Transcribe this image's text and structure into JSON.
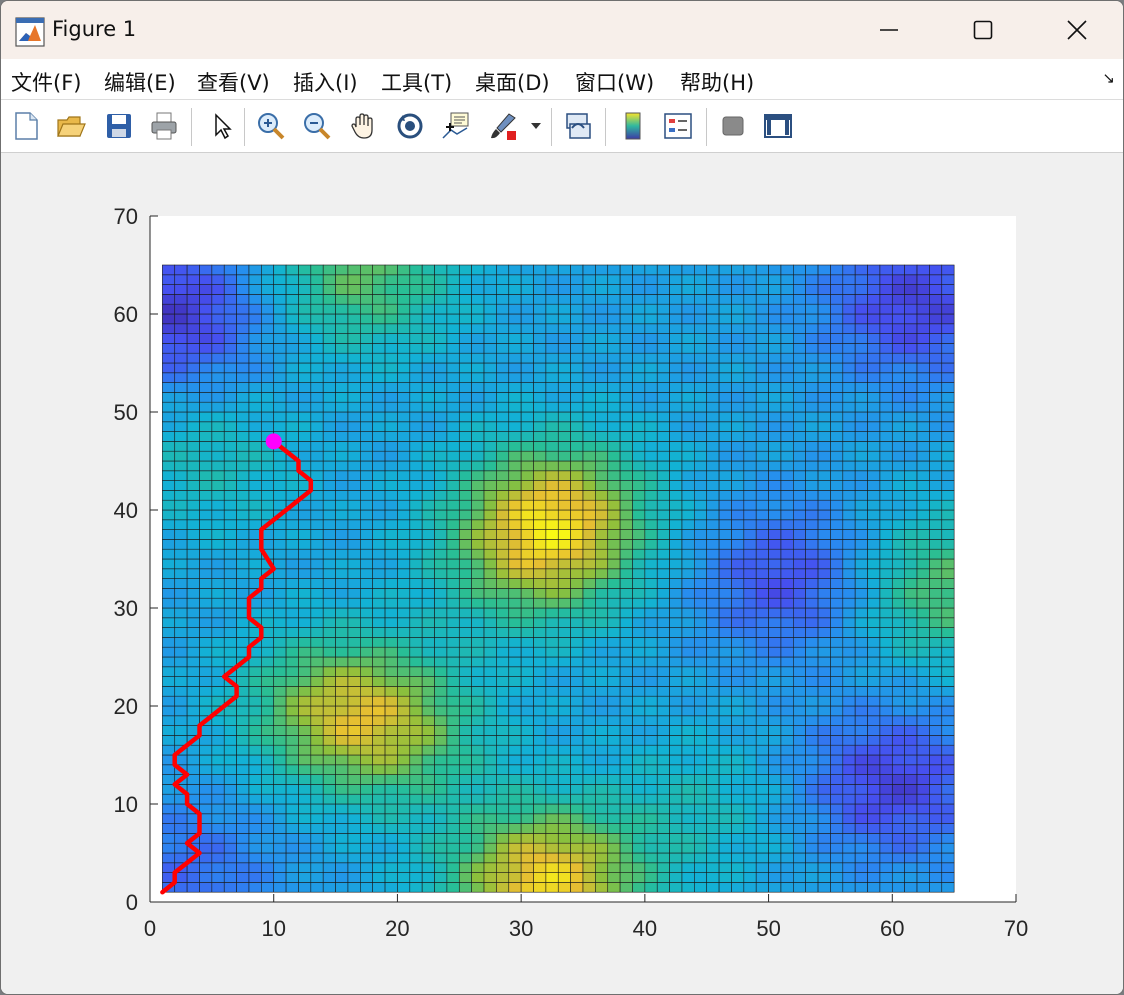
{
  "window": {
    "title": "Figure 1",
    "app_icon": "matlab-icon",
    "controls": {
      "minimize": "minimize-icon",
      "maximize": "maximize-icon",
      "close": "close-icon"
    }
  },
  "menu": [
    "文件(F)",
    "编辑(E)",
    "查看(V)",
    "插入(I)",
    "工具(T)",
    "桌面(D)",
    "窗口(W)",
    "帮助(H)"
  ],
  "toolbar": [
    {
      "name": "new-figure-icon"
    },
    {
      "name": "open-file-icon"
    },
    {
      "name": "save-icon"
    },
    {
      "name": "print-icon"
    },
    {
      "name": "edit-plot-arrow-icon"
    },
    {
      "name": "zoom-in-icon"
    },
    {
      "name": "zoom-out-icon"
    },
    {
      "name": "pan-hand-icon"
    },
    {
      "name": "rotate-3d-icon"
    },
    {
      "name": "data-cursor-icon"
    },
    {
      "name": "brush-icon"
    },
    {
      "name": "brush-dropdown-icon"
    },
    {
      "name": "link-plot-icon"
    },
    {
      "name": "colorbar-icon"
    },
    {
      "name": "legend-icon"
    },
    {
      "name": "hide-plot-tools-icon"
    },
    {
      "name": "show-plot-tools-icon"
    }
  ],
  "chart_data": {
    "type": "heatmap",
    "title": "",
    "xlabel": "",
    "ylabel": "",
    "xlim": [
      0,
      70
    ],
    "ylim": [
      0,
      70
    ],
    "xticks": [
      0,
      10,
      20,
      30,
      40,
      50,
      60,
      70
    ],
    "yticks": [
      0,
      10,
      20,
      30,
      40,
      50,
      60,
      70
    ],
    "grid_extent": {
      "x": [
        1,
        65
      ],
      "y": [
        1,
        65
      ]
    },
    "colormap": "parula",
    "surface_peaks": [
      {
        "x": 32,
        "y": 2,
        "level": 1.0
      },
      {
        "x": 33,
        "y": 40,
        "level": 0.72
      },
      {
        "x": 31,
        "y": 35,
        "level": 0.5
      },
      {
        "x": 15,
        "y": 20,
        "level": 0.6
      },
      {
        "x": 20,
        "y": 17,
        "level": 0.45
      },
      {
        "x": 17,
        "y": 64,
        "level": 0.55
      },
      {
        "x": 64,
        "y": 32,
        "level": 0.55
      },
      {
        "x": 5,
        "y": 45,
        "level": 0.25
      },
      {
        "x": 45,
        "y": 10,
        "level": 0.22
      }
    ],
    "surface_lows": [
      {
        "x": 2,
        "y": 60,
        "level": -0.55
      },
      {
        "x": 62,
        "y": 61,
        "level": -0.5
      },
      {
        "x": 52,
        "y": 33,
        "level": -0.45
      },
      {
        "x": 60,
        "y": 12,
        "level": -0.5
      },
      {
        "x": 3,
        "y": 3,
        "level": -0.3
      }
    ],
    "series": [
      {
        "color": "#ff0000",
        "x": [
          1,
          2,
          2,
          3,
          4,
          3,
          4,
          4,
          3,
          3,
          2,
          3,
          2,
          2,
          3,
          4,
          4,
          5,
          6,
          7,
          7,
          6,
          7,
          8,
          8,
          9,
          9,
          8,
          8,
          9,
          9,
          10,
          9,
          9,
          10,
          11,
          12,
          13,
          13,
          12,
          12,
          11,
          10
        ],
        "y": [
          1,
          2,
          3,
          4,
          5,
          6,
          7,
          9,
          10,
          11,
          12,
          13,
          14,
          15,
          16,
          17,
          18,
          19,
          20,
          21,
          22,
          23,
          24,
          25,
          26,
          27,
          28,
          29,
          31,
          32,
          33,
          34,
          36,
          38,
          39,
          40,
          41,
          42,
          43,
          44,
          45,
          46,
          47
        ]
      }
    ],
    "marker": {
      "x": 10,
      "y": 47,
      "color": "#ff00ff"
    }
  }
}
